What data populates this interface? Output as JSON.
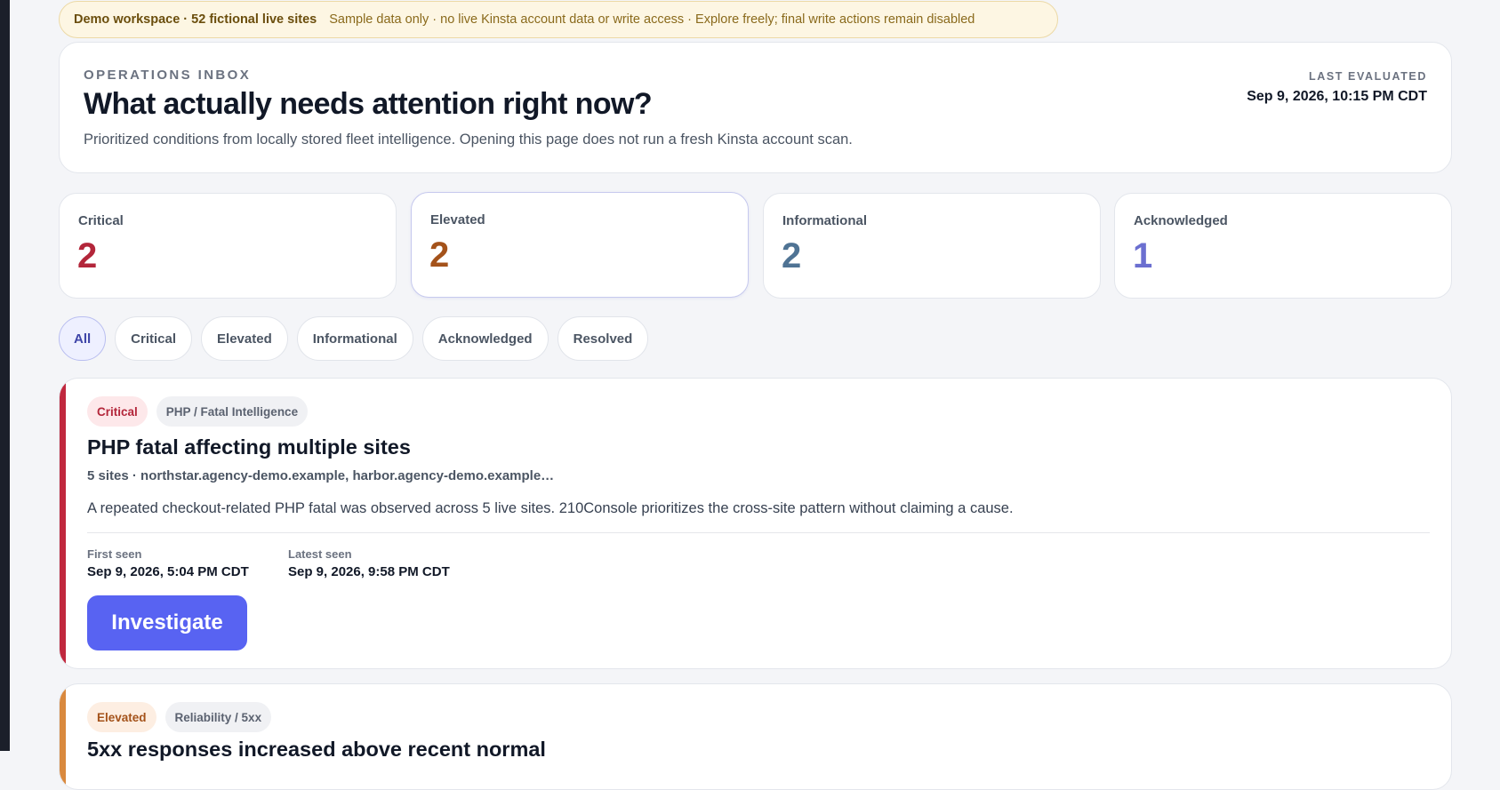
{
  "banner": {
    "workspace": "Demo workspace · 52 fictional live sites",
    "notice": "Sample data only · no live Kinsta account data or write access · Explore freely; final write actions remain disabled"
  },
  "header": {
    "eyebrow": "OPERATIONS INBOX",
    "title": "What actually needs attention right now?",
    "subtitle": "Prioritized conditions from locally stored fleet intelligence. Opening this page does not run a fresh Kinsta account scan.",
    "last_evaluated_label": "LAST EVALUATED",
    "last_evaluated_value": "Sep 9, 2026, 10:15 PM CDT"
  },
  "stats": [
    {
      "label": "Critical",
      "value": "2",
      "color": "#b3263a"
    },
    {
      "label": "Elevated",
      "value": "2",
      "color": "#a4521a"
    },
    {
      "label": "Informational",
      "value": "2",
      "color": "#4f7394"
    },
    {
      "label": "Acknowledged",
      "value": "1",
      "color": "#6b6fd0"
    }
  ],
  "filters": [
    "All",
    "Critical",
    "Elevated",
    "Informational",
    "Acknowledged",
    "Resolved"
  ],
  "active_filter": "All",
  "alerts": [
    {
      "severity": "Critical",
      "category": "PHP / Fatal Intelligence",
      "title": "PHP fatal affecting multiple sites",
      "sites": "5 sites · northstar.agency-demo.example, harbor.agency-demo.example…",
      "description": "A repeated checkout-related PHP fatal was observed across 5 live sites. 210Console prioritizes the cross-site pattern without claiming a cause.",
      "first_seen_label": "First seen",
      "first_seen": "Sep 9, 2026, 5:04 PM CDT",
      "latest_seen_label": "Latest seen",
      "latest_seen": "Sep 9, 2026, 9:58 PM CDT",
      "action": "Investigate",
      "accent": "#c0283e"
    },
    {
      "severity": "Elevated",
      "category": "Reliability / 5xx",
      "title": "5xx responses increased above recent normal",
      "accent": "#d9893e"
    }
  ]
}
